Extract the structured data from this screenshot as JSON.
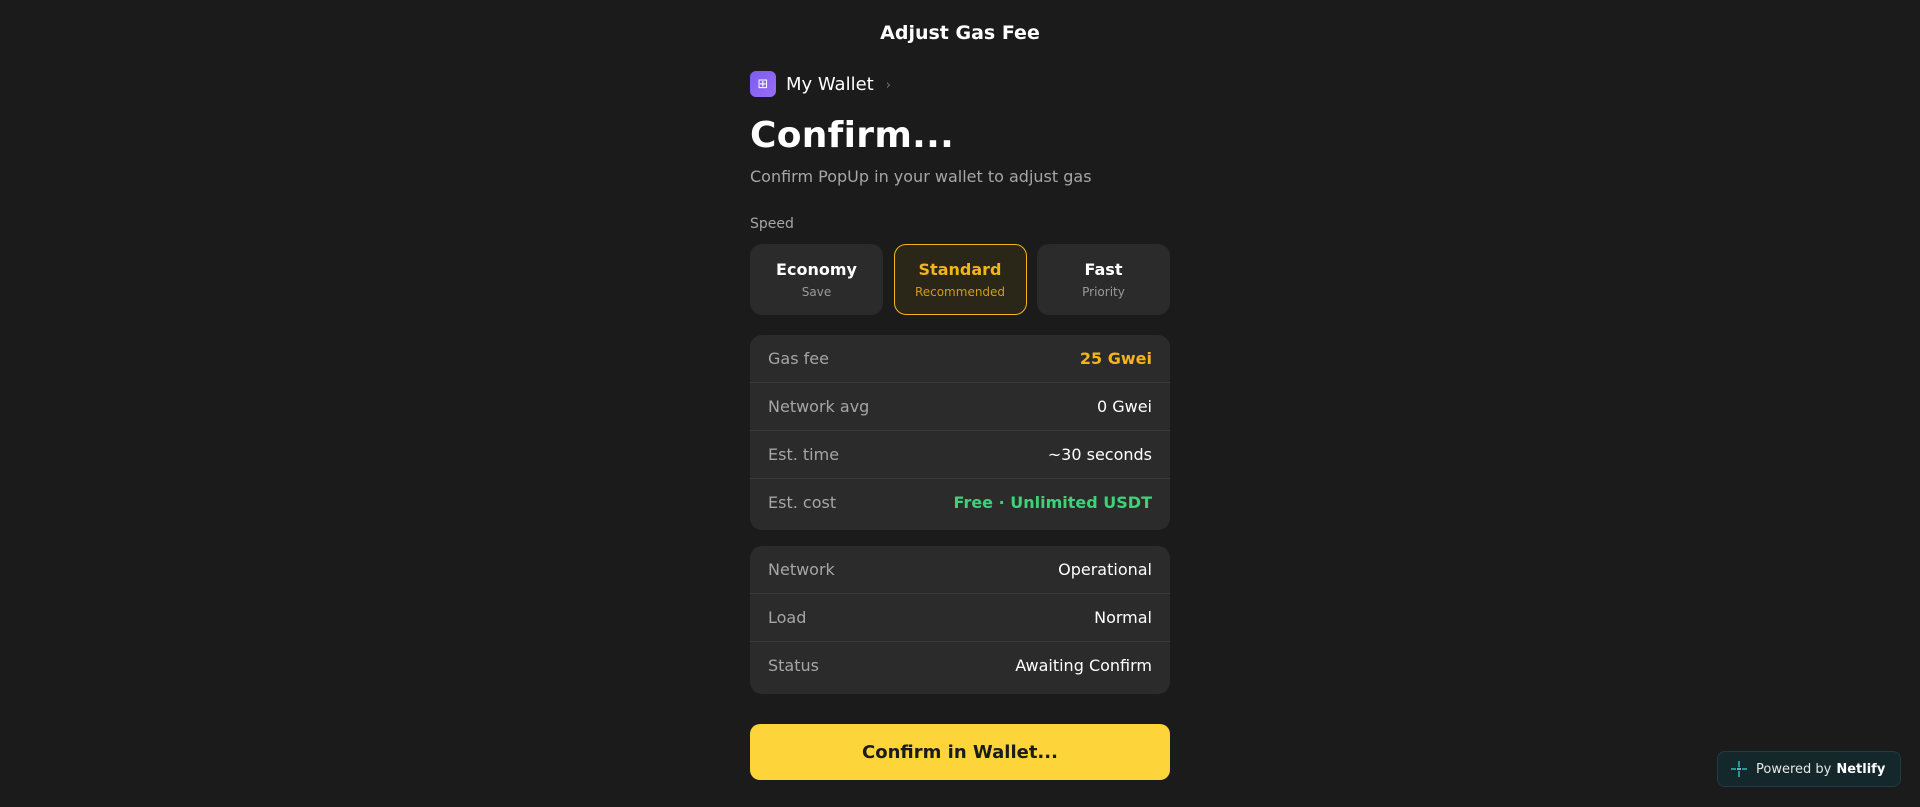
{
  "header": {
    "title": "Adjust Gas Fee"
  },
  "wallet": {
    "icon": "wallet-grid-icon",
    "glyph": "⊞",
    "name": "My Wallet",
    "chevron": "›"
  },
  "main": {
    "heading": "Confirm...",
    "subheading": "Confirm PopUp in your wallet to adjust gas",
    "speed_label": "Speed",
    "speed_options": [
      {
        "name": "Economy",
        "sub": "Save",
        "selected": false
      },
      {
        "name": "Standard",
        "sub": "Recommended",
        "selected": true
      },
      {
        "name": "Fast",
        "sub": "Priority",
        "selected": false
      }
    ],
    "fees": [
      {
        "label": "Gas fee",
        "value": "25 Gwei"
      },
      {
        "label": "Network avg",
        "value": "0 Gwei"
      },
      {
        "label": "Est. time",
        "value": "~30 seconds"
      },
      {
        "label": "Est. cost",
        "value": "Free · Unlimited USDT"
      }
    ],
    "network": [
      {
        "label": "Network",
        "value": "Operational"
      },
      {
        "label": "Load",
        "value": "Normal"
      },
      {
        "label": "Status",
        "value": "Awaiting Confirm"
      }
    ],
    "confirm_button": "Confirm in Wallet..."
  },
  "badge": {
    "prefix": "Powered by",
    "brand": "Netlify",
    "icon": "netlify-icon"
  },
  "colors": {
    "background": "#1b1b1b",
    "card": "#2b2b2b",
    "accent": "#f4b41b",
    "success": "#3fd17a",
    "button": "#fdd53a",
    "wallet_icon": "#8b63f2"
  }
}
